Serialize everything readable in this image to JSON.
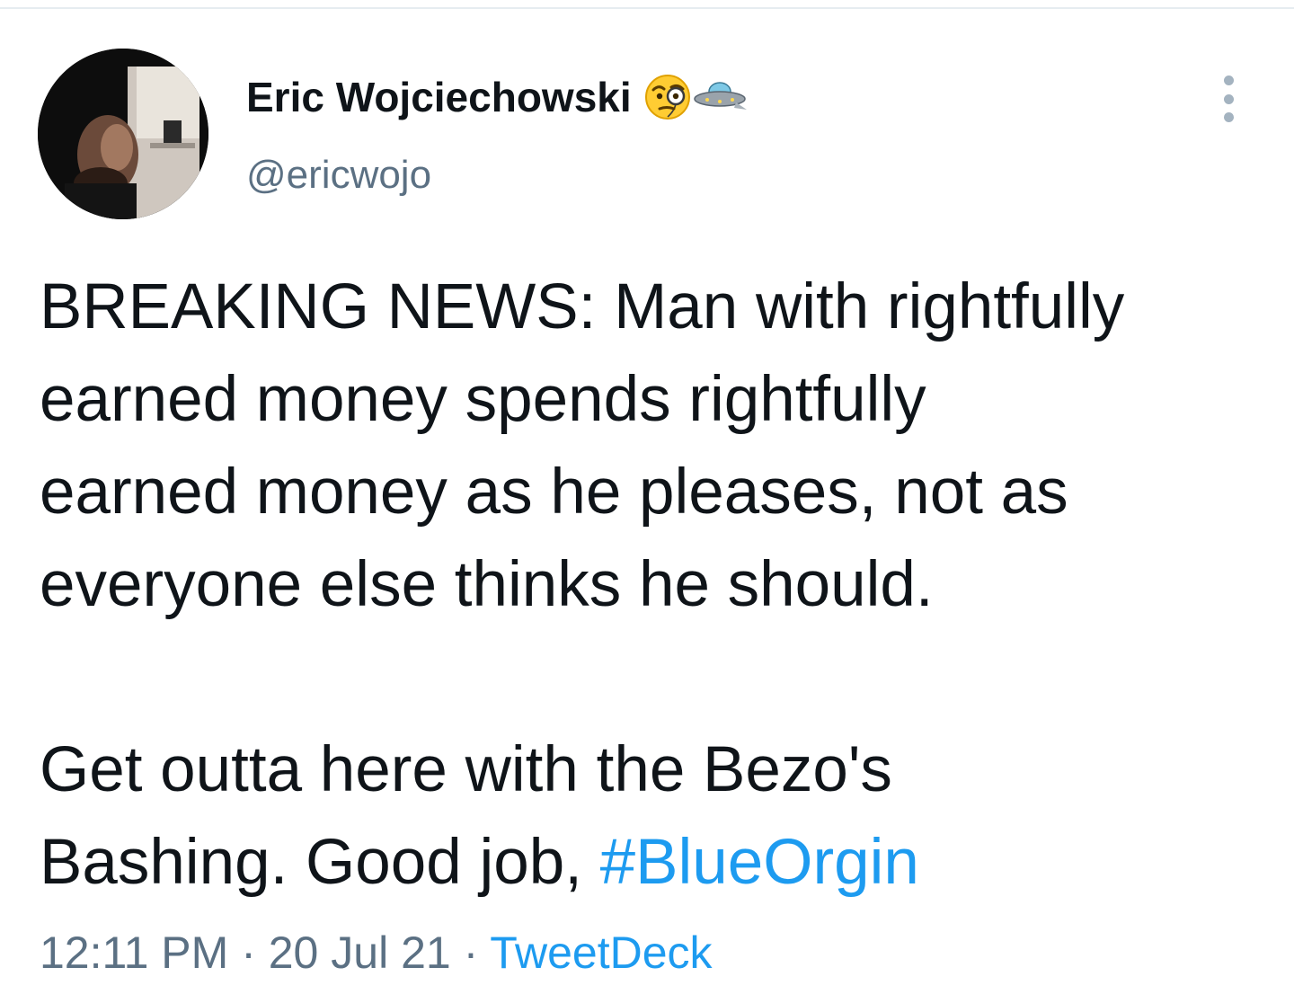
{
  "tweet": {
    "author": {
      "display_name": "Eric Wojciechowski",
      "handle": "@ericwojo",
      "name_emoji": [
        "face-with-monocle-icon",
        "flying-saucer-icon"
      ],
      "avatar": "profile-photo"
    },
    "menu_icon": "more-vertical-icon",
    "text": {
      "lines_para1": [
        "BREAKING NEWS: Man with rightfully",
        "earned money spends rightfully",
        "earned money as he pleases, not as",
        "everyone else thinks he should."
      ],
      "para2_line1": "Get outta here with the Bezo's",
      "para2_line2_prefix": "Bashing. Good job, ",
      "hashtag": "#BlueOrgin"
    },
    "meta": {
      "time": "12:11 PM",
      "separator": " · ",
      "date": "20 Jul 21",
      "source": "TweetDeck"
    }
  },
  "colors": {
    "text": "#0f1419",
    "secondary": "#5b7083",
    "link": "#1d9bf0"
  }
}
